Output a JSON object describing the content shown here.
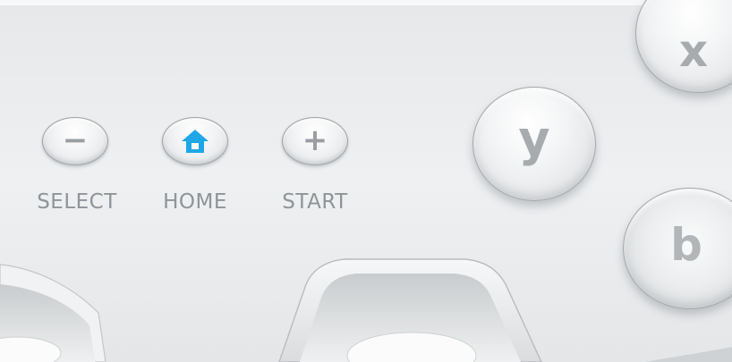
{
  "buttons": {
    "select": {
      "glyph": "−",
      "label": "SELECT"
    },
    "home": {
      "icon": "home-icon",
      "label": "HOME",
      "icon_color": "#1ea6e6"
    },
    "start": {
      "glyph": "+",
      "label": "START"
    }
  },
  "face_buttons": {
    "x": "x",
    "y": "y",
    "b": "b"
  },
  "colors": {
    "body": "#eceef0",
    "label_text": "#8f9498",
    "home_accent": "#1ea6e6"
  }
}
